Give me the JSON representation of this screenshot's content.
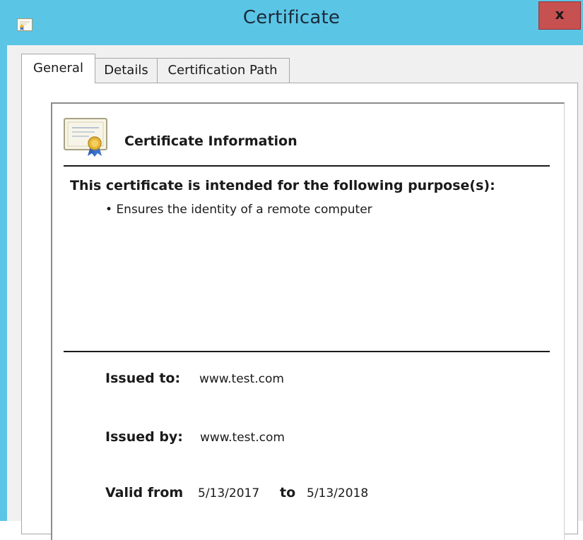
{
  "window": {
    "title": "Certificate",
    "close_label": "x"
  },
  "tabs": [
    {
      "label": "General",
      "selected": true
    },
    {
      "label": "Details",
      "selected": false
    },
    {
      "label": "Certification Path",
      "selected": false
    }
  ],
  "certificate": {
    "info_title": "Certificate Information",
    "purpose_heading": "This certificate is intended for the following purpose(s):",
    "purposes": [
      "Ensures the identity of a remote computer"
    ],
    "issued_to_label": "Issued to:",
    "issued_to_value": "www.test.com",
    "issued_by_label": "Issued by:",
    "issued_by_value": "www.test.com",
    "valid_from_label": "Valid from",
    "valid_from_value": "5/13/2017",
    "valid_to_label": "to",
    "valid_to_value": "5/13/2018"
  },
  "icons": {
    "app": "certificate-icon",
    "certificate": "certificate-ribbon-icon",
    "close": "close-icon"
  },
  "colors": {
    "titlebar": "#5bc5e6",
    "close_button": "#c75050",
    "client_background": "#f0f0f0",
    "panel_background": "#ffffff"
  }
}
